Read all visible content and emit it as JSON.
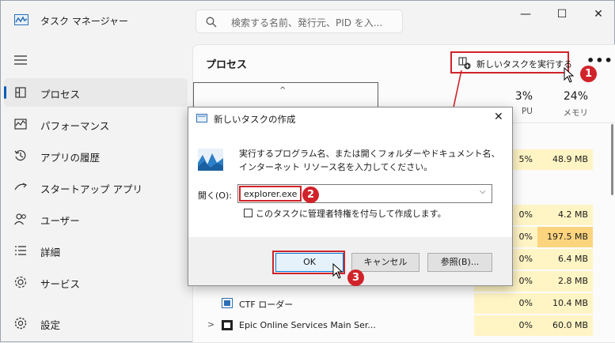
{
  "app": {
    "title": "タスク マネージャー"
  },
  "search": {
    "placeholder": "検索する名前、発行元、PID を入..."
  },
  "window_controls": {
    "minimize": "—",
    "maximize": "☐",
    "close": "✕"
  },
  "sidebar": {
    "items": [
      {
        "label": "プロセス",
        "icon": "processes-icon",
        "active": true
      },
      {
        "label": "パフォーマンス",
        "icon": "performance-icon"
      },
      {
        "label": "アプリの履歴",
        "icon": "history-icon"
      },
      {
        "label": "スタートアップ アプリ",
        "icon": "startup-icon"
      },
      {
        "label": "ユーザー",
        "icon": "users-icon"
      },
      {
        "label": "詳細",
        "icon": "details-icon"
      },
      {
        "label": "サービス",
        "icon": "services-icon"
      },
      {
        "label": "設定",
        "icon": "settings-icon"
      }
    ]
  },
  "main": {
    "title": "プロセス",
    "run_task_label": "新しいタスクを実行する",
    "more": "•••",
    "columns": {
      "cpu_pct": "3%",
      "cpu_label": "PU",
      "mem_pct": "24%",
      "mem_label": "メモリ"
    },
    "rows": [
      {
        "cpu": "5%",
        "mem": "48.9 MB"
      },
      {
        "cpu": "0%",
        "mem": "4.2 MB"
      },
      {
        "cpu": "0%",
        "mem": "197.5 MB"
      },
      {
        "cpu": "0%",
        "mem": "6.4 MB"
      },
      {
        "cpu": "0%",
        "mem": "2.8 MB"
      },
      {
        "cpu": "0%",
        "mem": "10.4 MB",
        "name": "CTF ローダー"
      },
      {
        "cpu": "0%",
        "mem": "60.0 MB",
        "name": "Epic Online Services Main Ser..."
      }
    ]
  },
  "dialog": {
    "title": "新しいタスクの作成",
    "description": "実行するプログラム名、または開くフォルダーやドキュメント名、インターネット リソース名を入力してください。",
    "open_label": "開く(O):",
    "open_value": "explorer.exe",
    "admin_checkbox_label": "このタスクに管理者特権を付与して作成します。",
    "ok_label": "OK",
    "cancel_label": "キャンセル",
    "browse_label": "参照(B)..."
  },
  "annotations": {
    "step1": "1",
    "step2": "2",
    "step3": "3"
  },
  "colors": {
    "accent": "#005fb8",
    "highlight": "#d1232a",
    "cpu_fill": "#fff4c4",
    "mem_hot": "#fcd47e"
  }
}
